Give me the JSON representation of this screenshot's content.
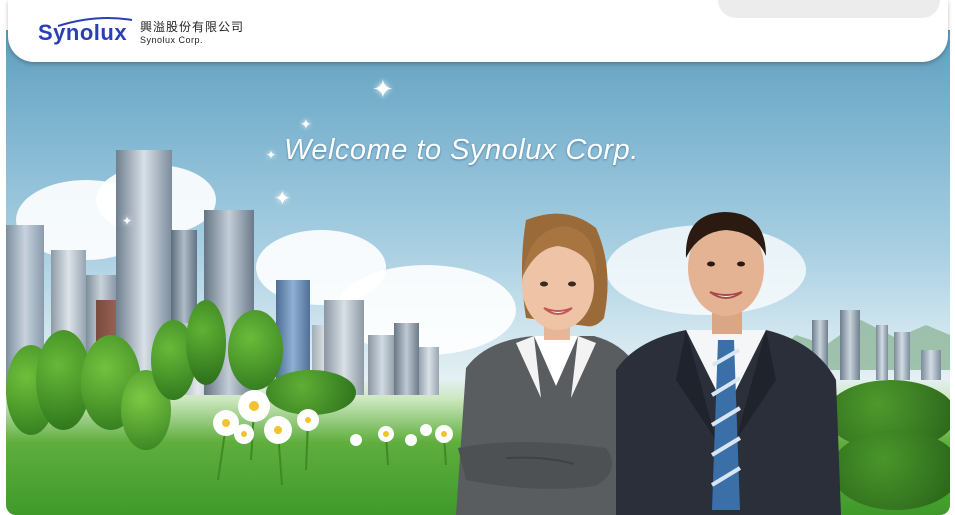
{
  "header": {
    "logo_text": "Synolux",
    "company_name_cn": "興溢股份有限公司",
    "company_name_en": "Synolux Corp."
  },
  "banner": {
    "welcome": "Welcome to Synolux Corp."
  },
  "colors": {
    "brand_blue": "#2a3fb5",
    "sky_top": "#5f9fbf",
    "grass": "#3f9a2a"
  }
}
